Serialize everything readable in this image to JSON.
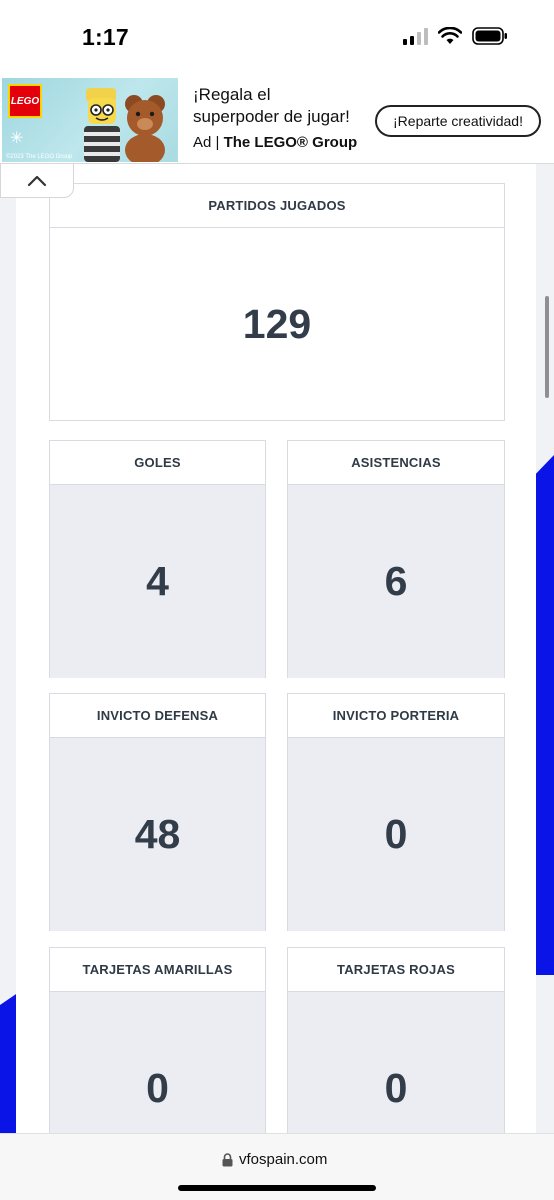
{
  "status_bar": {
    "time": "1:17"
  },
  "ad": {
    "headline_line1": "¡Regala el",
    "headline_line2": "superpoder de jugar!",
    "ad_label": "Ad |",
    "advertiser": "The LEGO® Group",
    "cta_label": "¡Reparte creatividad!",
    "logo_text": "LEGO",
    "copyright": "©2023 The LEGO Group"
  },
  "stats": {
    "partidos": {
      "label": "PARTIDOS JUGADOS",
      "value": "129"
    },
    "goles": {
      "label": "GOLES",
      "value": "4"
    },
    "asistencias": {
      "label": "ASISTENCIAS",
      "value": "6"
    },
    "invicto_defensa": {
      "label": "INVICTO DEFENSA",
      "value": "48"
    },
    "invicto_porteria": {
      "label": "INVICTO PORTERIA",
      "value": "0"
    },
    "tarjetas_amarillas": {
      "label": "TARJETAS AMARILLAS",
      "value": "0"
    },
    "tarjetas_rojas": {
      "label": "TARJETAS ROJAS",
      "value": "0"
    }
  },
  "browser": {
    "url": "vfospain.com"
  },
  "colors": {
    "accent_stripe": "#0a14e6",
    "card_gray": "#ecedf2",
    "text_dark": "#2f3a46"
  }
}
